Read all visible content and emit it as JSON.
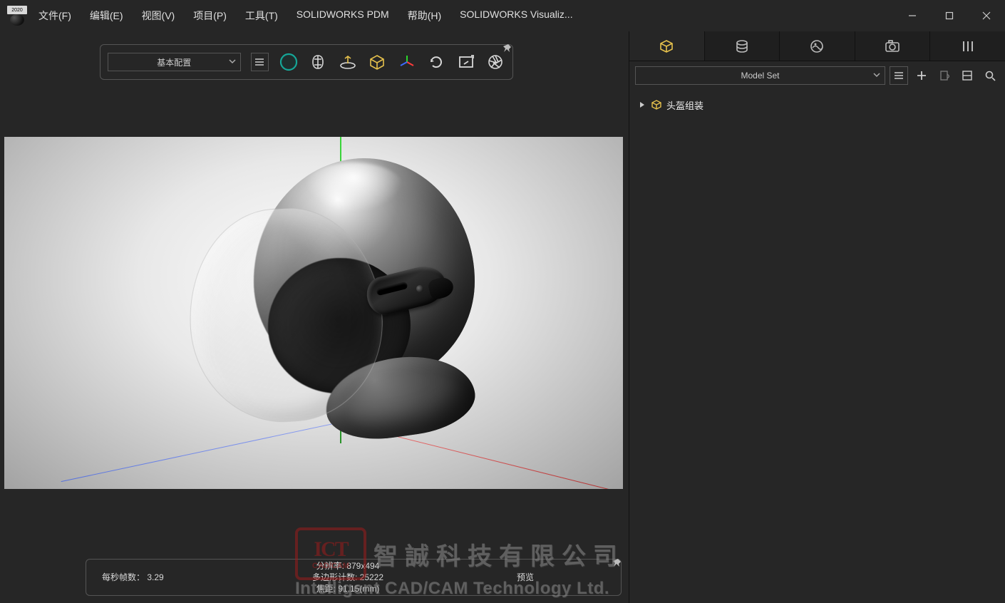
{
  "app": {
    "logo_year": "2020"
  },
  "menu": {
    "file": "文件(F)",
    "edit": "编辑(E)",
    "view": "视图(V)",
    "project": "项目(P)",
    "tools": "工具(T)",
    "pdm": "SOLIDWORKS PDM",
    "help": "帮助(H)",
    "visualize": "SOLIDWORKS Visualiz..."
  },
  "toolbar": {
    "config_label": "基本配置"
  },
  "status": {
    "fps_label": "每秒帧数：",
    "fps_value": "3.29",
    "res_label": "分辨率:",
    "res_value": "879x494",
    "poly_label": "多边形计数:",
    "poly_value": "25222",
    "focal_label": "焦距:",
    "focal_value": "91.15(mm)",
    "preview_label": "预览"
  },
  "right_panel": {
    "dropdown_label": "Model Set",
    "tree_root": "头盔组装"
  },
  "watermark": {
    "logo_big": "ICT",
    "logo_small": "CAD/CAM",
    "cn": "智誠科技有限公司",
    "en": "Intelligent CAD/CAM Technology Ltd."
  }
}
